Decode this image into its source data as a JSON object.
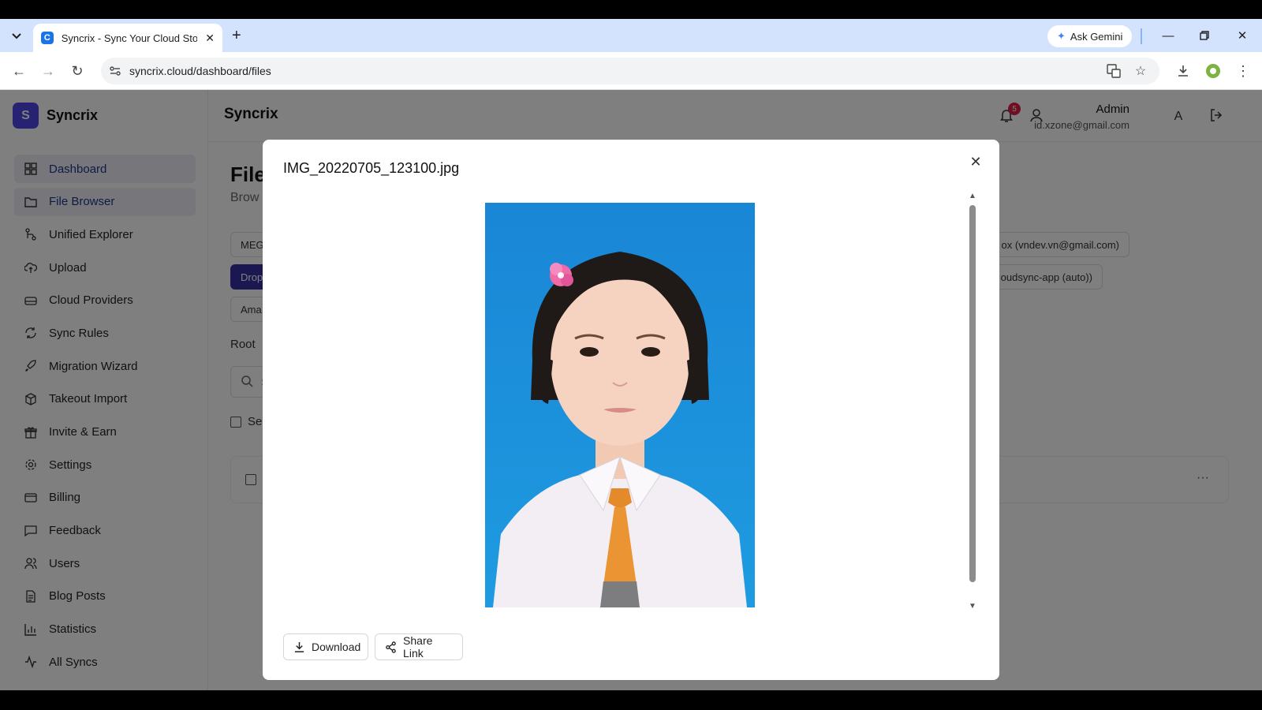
{
  "browser": {
    "tab_title": "Syncrix - Sync Your Cloud Storage",
    "favicon_letter": "C",
    "ask_gemini": "Ask Gemini",
    "url": "syncrix.cloud/dashboard/files"
  },
  "app": {
    "brand_letter": "S",
    "brand_name": "Syncrix",
    "top_title": "Syncrix",
    "notification_count": "5",
    "user": {
      "name": "Admin",
      "email": "id.xzone@gmail.com",
      "avatar_letter": "A"
    }
  },
  "sidebar": {
    "items": [
      {
        "label": "Dashboard",
        "icon": "grid-icon"
      },
      {
        "label": "File Browser",
        "icon": "folder-icon"
      },
      {
        "label": "Unified Explorer",
        "icon": "merge-icon"
      },
      {
        "label": "Upload",
        "icon": "cloud-upload-icon"
      },
      {
        "label": "Cloud Providers",
        "icon": "hard-drive-icon"
      },
      {
        "label": "Sync Rules",
        "icon": "refresh-icon"
      },
      {
        "label": "Migration Wizard",
        "icon": "rocket-icon"
      },
      {
        "label": "Takeout Import",
        "icon": "package-icon"
      },
      {
        "label": "Invite & Earn",
        "icon": "gift-icon"
      },
      {
        "label": "Settings",
        "icon": "gear-icon"
      },
      {
        "label": "Billing",
        "icon": "credit-card-icon"
      },
      {
        "label": "Feedback",
        "icon": "message-icon"
      },
      {
        "label": "Users",
        "icon": "users-icon"
      },
      {
        "label": "Blog Posts",
        "icon": "document-icon"
      },
      {
        "label": "Statistics",
        "icon": "bar-chart-icon"
      },
      {
        "label": "All Syncs",
        "icon": "activity-icon"
      }
    ]
  },
  "main": {
    "title": "File",
    "subtitle": "Brow",
    "providers": [
      {
        "left_label": "MEG",
        "right_label": "ox (vndev.vn@gmail.com)"
      },
      {
        "left_label": "Drop",
        "right_label": "oudsync-app (auto))"
      },
      {
        "left_label": "Ama"
      }
    ],
    "breadcrumb": "Root",
    "search_placeholder": "S",
    "select_all": "Se",
    "row_more": "···"
  },
  "modal": {
    "title": "IMG_20220705_123100.jpg",
    "download_label": "Download",
    "share_label": "Share Link"
  }
}
